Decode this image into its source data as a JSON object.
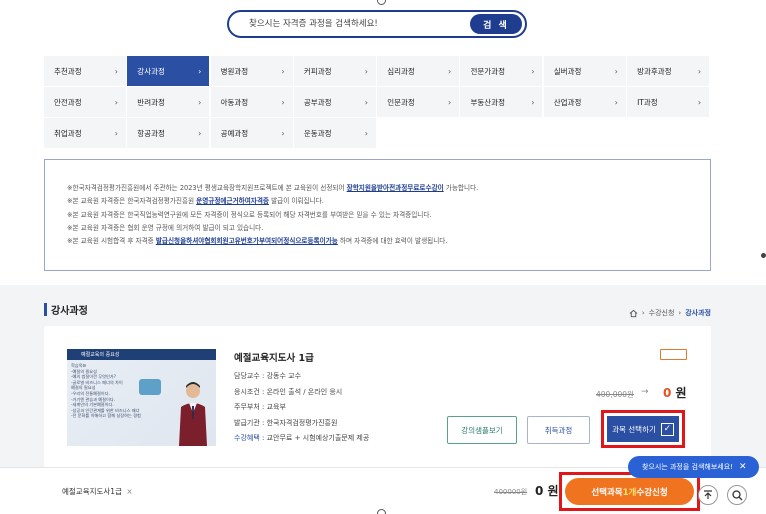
{
  "search": {
    "placeholder": "찾으시는 자격증 과정을 검색하세요!",
    "button_label": "검 색"
  },
  "categories": [
    {
      "label": "추천과정",
      "active": false
    },
    {
      "label": "강사과정",
      "active": true
    },
    {
      "label": "병원과정",
      "active": false
    },
    {
      "label": "커피과정",
      "active": false
    },
    {
      "label": "심리과정",
      "active": false
    },
    {
      "label": "전문가과정",
      "active": false
    },
    {
      "label": "실버과정",
      "active": false
    },
    {
      "label": "방과후과정",
      "active": false
    },
    {
      "label": "안전과정",
      "active": false
    },
    {
      "label": "반려과정",
      "active": false
    },
    {
      "label": "아동과정",
      "active": false
    },
    {
      "label": "공부과정",
      "active": false
    },
    {
      "label": "인문과정",
      "active": false
    },
    {
      "label": "부동산과정",
      "active": false
    },
    {
      "label": "산업과정",
      "active": false
    },
    {
      "label": "IT과정",
      "active": false
    },
    {
      "label": "취업과정",
      "active": false
    },
    {
      "label": "항공과정",
      "active": false
    },
    {
      "label": "공예과정",
      "active": false
    },
    {
      "label": "운동과정",
      "active": false
    }
  ],
  "notice": {
    "line1_pre": "※한국자격검정평가진흥원에서 주관하는 2023년 평생교육장학지원프로젝트에 본 교육원이 선정되어 ",
    "line1_hl": "장학지원을받아전과정무료로수강이",
    "line1_post": " 가능합니다.",
    "line2_pre": "※본 교육원 자격증은 한국자격검정평가진흥원 ",
    "line2_hl": "운영규정에근거하여자격증",
    "line2_post": " 발급이 이뤄집니다.",
    "line3": "※본 교육원 자격증은 한국직업능력연구원에 모든 자격증이 정식으로 등록되어 해당 자격번호를 부여받은 믿을 수 있는 자격증입니다.",
    "line4": "※본 교육원 자격증은 협회 운영 규정에 의거하여 발급이 되고 있습니다.",
    "line5_pre": "※본 교육원 시험합격 후 자격증 ",
    "line5_hl": "발급신청을하셔야협회회원고유번호가부여되어정식으로등록이가능",
    "line5_post": " 하며 자격증에 대한 효력이 발생됩니다."
  },
  "section": {
    "title": "강사과정",
    "breadcrumb": [
      "수강신청",
      "강사과정"
    ]
  },
  "course": {
    "thumb_title": "예절교육의 중요성",
    "thumb_lines": [
      "학습목표",
      "-예절의 필요성",
      "-예의 범절이란 무엇인가?",
      "-글로벌 비즈니스 매너의 차이",
      "예절의 필요성",
      "-우리의 전통예절이다.",
      "-거기엔 관습과 예절이다.",
      "-세계인의 기본예절이다.",
      "-성공과 인간관계를 위한 비즈니스 매너",
      "-전 문화를 이해하고 함께 성장하는 경험"
    ],
    "title": "예절교육지도사 1급",
    "instructor_label": "담당교수",
    "instructor": "강동수 교수",
    "condition_label": "응시조건",
    "condition": "온라인 출석 / 온라인 응시",
    "dept_label": "주무부처",
    "dept": "교육부",
    "issuer_label": "발급기관",
    "issuer": "한국자격검정평가진흥원",
    "benefit_label": "수강혜택",
    "benefit": "교안무료 + 시험예상기출문제 제공",
    "old_price": "400,000원",
    "arrow": "→",
    "new_price_num": "0",
    "new_price_unit": " 원",
    "btn_sample": "강의샘플보기",
    "btn_process": "취득과정",
    "btn_select": "과목 선택하기",
    "check": "✓"
  },
  "bottom": {
    "selected_item": "예절교육지도사1급",
    "remove": "×",
    "old_price": "400000원",
    "new_price": "0 원",
    "enroll_pre": "선택과목 ",
    "enroll_count": "1개",
    "enroll_post": " 수강신청"
  },
  "tooltip": {
    "text": "찾으시는 과정을 검색해보세요!",
    "close": "✕"
  },
  "colors": {
    "brand_blue": "#2a4fa3",
    "orange": "#f0741f",
    "highlight_red": "#e0161b"
  }
}
